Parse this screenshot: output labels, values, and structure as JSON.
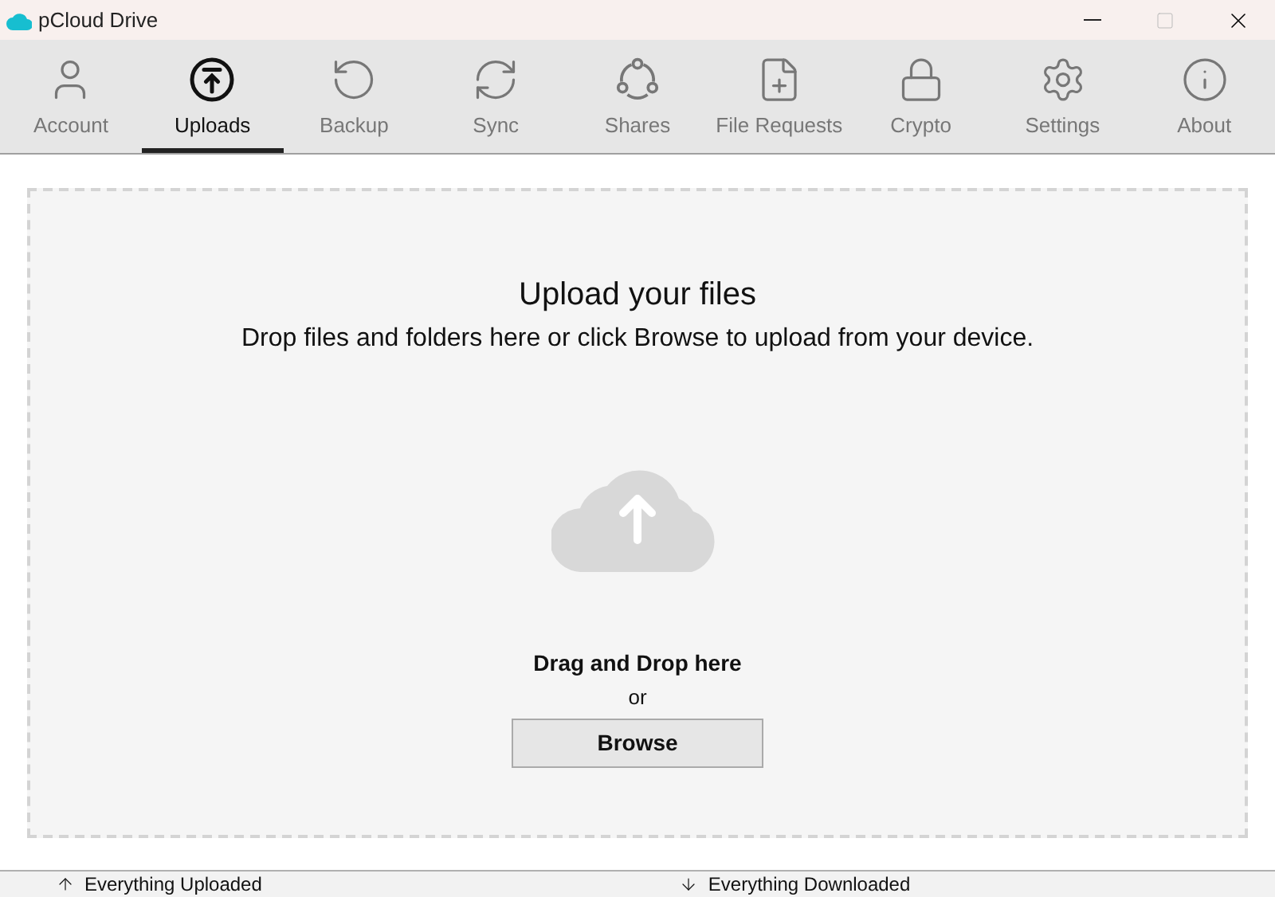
{
  "window": {
    "title": "pCloud Drive"
  },
  "tabs": [
    {
      "label": "Account",
      "selected": false
    },
    {
      "label": "Uploads",
      "selected": true
    },
    {
      "label": "Backup",
      "selected": false
    },
    {
      "label": "Sync",
      "selected": false
    },
    {
      "label": "Shares",
      "selected": false
    },
    {
      "label": "File Requests",
      "selected": false
    },
    {
      "label": "Crypto",
      "selected": false
    },
    {
      "label": "Settings",
      "selected": false
    },
    {
      "label": "About",
      "selected": false
    }
  ],
  "drop_zone": {
    "title": "Upload your files",
    "subtitle": "Drop files and folders here or click Browse to upload from your device.",
    "drag_text": "Drag and Drop here",
    "or_text": "or",
    "button": "Browse"
  },
  "status_bar": {
    "uploads": "Everything Uploaded",
    "downloads": "Everything Downloaded"
  }
}
